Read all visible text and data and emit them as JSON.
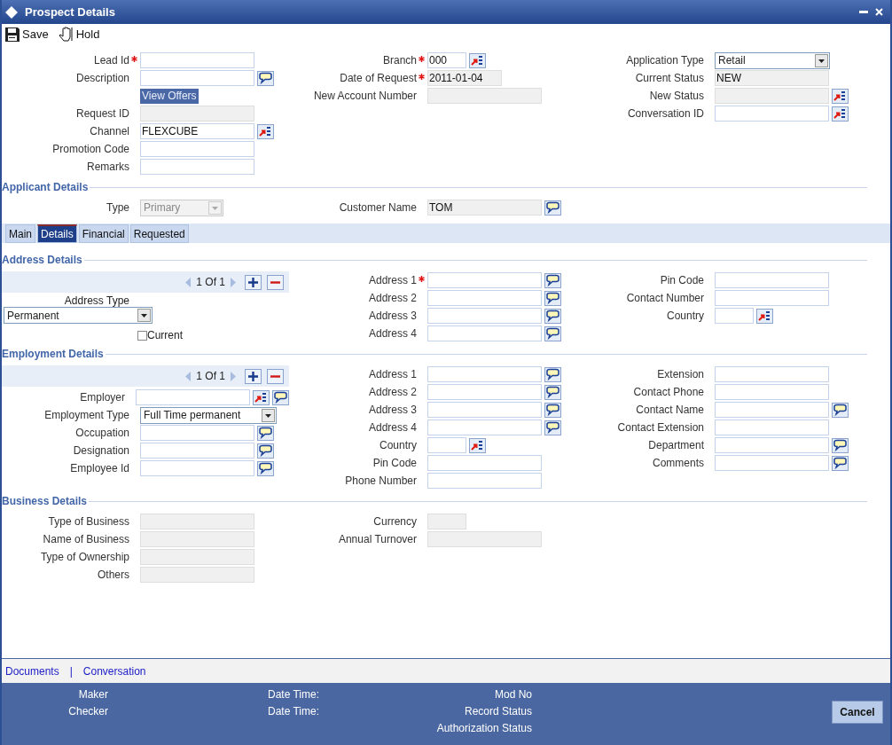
{
  "window": {
    "title": "Prospect Details"
  },
  "toolbar": [
    "Save",
    "Hold"
  ],
  "sections": [
    {
      "kind": "form",
      "columns": [
        [
          {
            "kind": "text",
            "label": "Lead Id",
            "required": true,
            "disabled": false
          },
          {
            "kind": "text",
            "label": "Description",
            "required": false,
            "disabled": false,
            "comments": true
          },
          {
            "kind": "button",
            "value": "View Offers"
          },
          {
            "kind": "text",
            "label": "Request ID",
            "required": false,
            "disabled": true
          },
          {
            "kind": "text",
            "label": "Channel",
            "required": false,
            "disabled": false,
            "value": "FLEXCUBE",
            "lookup": true
          },
          {
            "kind": "text",
            "label": "Promotion Code",
            "required": false,
            "disabled": false
          },
          {
            "kind": "text",
            "label": "Remarks",
            "required": false,
            "disabled": false
          }
        ],
        [
          {
            "kind": "code",
            "label": "Branch",
            "required": true,
            "disabled": false,
            "value": "000",
            "lookup": true
          },
          {
            "kind": "date",
            "label": "Date of Request",
            "required": true,
            "disabled": true,
            "value": "2011-01-04"
          },
          {
            "kind": "text",
            "label": "New Account Number",
            "required": false,
            "disabled": true
          }
        ],
        [
          {
            "kind": "select",
            "label": "Application Type",
            "required": false,
            "disabled": false,
            "value": "Retail"
          },
          {
            "kind": "text",
            "label": "Current Status",
            "required": false,
            "disabled": true,
            "value": "NEW"
          },
          {
            "kind": "text",
            "label": "New Status",
            "required": false,
            "disabled": true,
            "lookup": true
          },
          {
            "kind": "text",
            "label": "Conversation ID",
            "required": false,
            "disabled": false,
            "lookup": true
          }
        ]
      ]
    },
    {
      "kind": "form",
      "heading": "Applicant Details",
      "columns": [
        [
          {
            "kind": "select",
            "label": "Type",
            "required": false,
            "disabled": true,
            "value": "Primary"
          }
        ],
        [
          {
            "kind": "text",
            "label": "Customer Name",
            "required": false,
            "disabled": true,
            "value": "TOM",
            "comments": true
          }
        ]
      ]
    },
    {
      "kind": "tabs",
      "tabs": [
        {
          "label": "Main",
          "selected": false
        },
        {
          "label": "Details",
          "selected": true
        },
        {
          "label": "Financial",
          "selected": false
        },
        {
          "label": "Requested",
          "selected": false
        }
      ]
    },
    {
      "kind": "form",
      "heading": "Address Details",
      "pager": "1 Of 1",
      "columns": [
        [
          {
            "kind": "stacked-select",
            "label": "Address Type",
            "disabled": false,
            "value": "Permanent"
          },
          {
            "kind": "checkbox",
            "label": "Current",
            "checked": false
          }
        ],
        [
          {
            "kind": "text",
            "label": "Address 1",
            "required": true,
            "disabled": false,
            "comments": true
          },
          {
            "kind": "text",
            "label": "Address 2",
            "required": false,
            "disabled": false,
            "comments": true
          },
          {
            "kind": "text",
            "label": "Address 3",
            "required": false,
            "disabled": false,
            "comments": true
          },
          {
            "kind": "text",
            "label": "Address 4",
            "required": false,
            "disabled": false,
            "comments": true
          }
        ],
        [
          {
            "kind": "text",
            "label": "Pin Code",
            "required": false,
            "disabled": false
          },
          {
            "kind": "text",
            "label": "Contact Number",
            "required": false,
            "disabled": false
          },
          {
            "kind": "code",
            "label": "Country",
            "required": false,
            "disabled": false,
            "lookup": true
          }
        ]
      ]
    },
    {
      "kind": "form",
      "heading": "Employment Details",
      "pager": "1 Of 1",
      "columns": [
        [
          {
            "kind": "text",
            "label": "Employer",
            "required": false,
            "disabled": false,
            "lookup": true,
            "comments": true
          },
          {
            "kind": "select",
            "label": "Employment Type",
            "required": false,
            "disabled": false,
            "value": "Full Time permanent"
          },
          {
            "kind": "text",
            "label": "Occupation",
            "required": false,
            "disabled": false,
            "comments": true
          },
          {
            "kind": "text",
            "label": "Designation",
            "required": false,
            "disabled": false,
            "comments": true
          },
          {
            "kind": "text",
            "label": "Employee Id",
            "required": false,
            "disabled": false,
            "comments": true
          }
        ],
        [
          {
            "kind": "text",
            "label": "Address 1",
            "required": false,
            "disabled": false,
            "comments": true
          },
          {
            "kind": "text",
            "label": "Address 2",
            "required": false,
            "disabled": false,
            "comments": true
          },
          {
            "kind": "text",
            "label": "Address 3",
            "required": false,
            "disabled": false,
            "comments": true
          },
          {
            "kind": "text",
            "label": "Address 4",
            "required": false,
            "disabled": false,
            "comments": true
          },
          {
            "kind": "code",
            "label": "Country",
            "required": false,
            "disabled": false,
            "lookup": true
          },
          {
            "kind": "text",
            "label": "Pin Code",
            "required": false,
            "disabled": false
          },
          {
            "kind": "text",
            "label": "Phone Number",
            "required": false,
            "disabled": false
          }
        ],
        [
          {
            "kind": "text",
            "label": "Extension",
            "required": false,
            "disabled": false
          },
          {
            "kind": "text",
            "label": "Contact Phone",
            "required": false,
            "disabled": false
          },
          {
            "kind": "text",
            "label": "Contact Name",
            "required": false,
            "disabled": false,
            "comments": true
          },
          {
            "kind": "text",
            "label": "Contact Extension",
            "required": false,
            "disabled": false
          },
          {
            "kind": "text",
            "label": "Department",
            "required": false,
            "disabled": false,
            "comments": true
          },
          {
            "kind": "text",
            "label": "Comments",
            "required": false,
            "disabled": false,
            "comments": true
          }
        ]
      ]
    },
    {
      "kind": "form",
      "heading": "Business Details",
      "columns": [
        [
          {
            "kind": "text",
            "label": "Type of Business",
            "required": false,
            "disabled": true
          },
          {
            "kind": "text",
            "label": "Name of Business",
            "required": false,
            "disabled": true
          },
          {
            "kind": "text",
            "label": "Type of Ownership",
            "required": false,
            "disabled": true
          },
          {
            "kind": "text",
            "label": "Others",
            "required": false,
            "disabled": true
          }
        ],
        [
          {
            "kind": "code",
            "label": "Currency",
            "required": false,
            "disabled": true
          },
          {
            "kind": "text",
            "label": "Annual Turnover",
            "required": false,
            "disabled": true
          }
        ]
      ]
    }
  ],
  "links": [
    "Documents",
    "|",
    "Conversation"
  ],
  "audit": [
    [
      "Maker",
      "Checker"
    ],
    [
      "Date Time:",
      "Date Time:"
    ],
    [
      "Mod No",
      "Record Status",
      "Authorization Status"
    ]
  ],
  "cancel_button": "Cancel"
}
